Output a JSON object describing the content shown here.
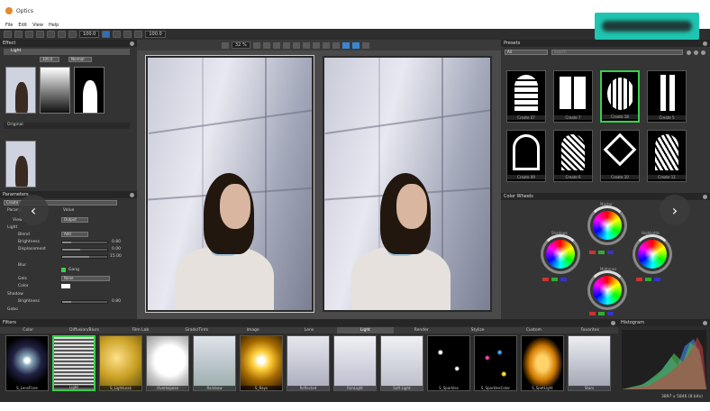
{
  "window": {
    "title": "Optics"
  },
  "menu": {
    "items": [
      "File",
      "Edit",
      "View",
      "Help"
    ]
  },
  "toolbar": {
    "field1": "100.0",
    "field2": "100.0"
  },
  "effect_panel": {
    "title": "Effect",
    "layer_name": "Light",
    "opacity": "100.0",
    "blend": "Normal",
    "original_label": "Original"
  },
  "params_panel": {
    "title": "Parameters",
    "preset_label": "Create",
    "col_param": "Params",
    "col_value": "Value",
    "rows": [
      {
        "label": "View",
        "value": "Output"
      },
      {
        "label": "Light",
        "value": ""
      },
      {
        "label": "Blend",
        "value": "Add"
      },
      {
        "label": "Brightness",
        "value": "0.80"
      },
      {
        "label": "Displacement",
        "value": "0.00"
      },
      {
        "label": "",
        "value": "15.00"
      },
      {
        "label": "Blur",
        "value": ""
      },
      {
        "label": "Gang",
        "value": ""
      },
      {
        "label": "Gels",
        "value": "None"
      },
      {
        "label": "Color",
        "value": ""
      },
      {
        "label": "Shadow",
        "value": ""
      },
      {
        "label": "Brightness",
        "value": "0.80"
      },
      {
        "label": "Gobo",
        "value": ""
      }
    ]
  },
  "center": {
    "zoom": "32 %"
  },
  "presets": {
    "title": "Presets",
    "filter": "All",
    "search_placeholder": "Search",
    "items": [
      "Create 07",
      "Create 7",
      "Create 18",
      "Create 5",
      "Create 09",
      "Create 6",
      "Create 10",
      "Create 11"
    ]
  },
  "color_wheels": {
    "title": "Color Wheels",
    "labels": [
      "Master",
      "Shadows",
      "Highlights",
      "Midtones"
    ]
  },
  "filters": {
    "title": "Filters",
    "tabs": [
      "Color",
      "Diffusion/Blurs",
      "Film Lab",
      "Grads/Tints",
      "Image",
      "Lens",
      "Light",
      "Render",
      "Stylize",
      "Custom",
      "Favorites"
    ],
    "active_tab": "Light",
    "items": [
      "S_LensFlare",
      "Light",
      "S_LightLeak",
      "Overexpose",
      "Rainbow",
      "S_Rays",
      "Reflected",
      "RimLight",
      "Soft Light",
      "S_Sparkles",
      "S_SparklesColor",
      "S_SpotLight",
      "Stars"
    ]
  },
  "histogram": {
    "title": "Histogram",
    "info": "3897 x 5846 (8 bits)"
  },
  "colors": {
    "accent_green": "#39d04a",
    "badge": "#1fc5b1"
  }
}
